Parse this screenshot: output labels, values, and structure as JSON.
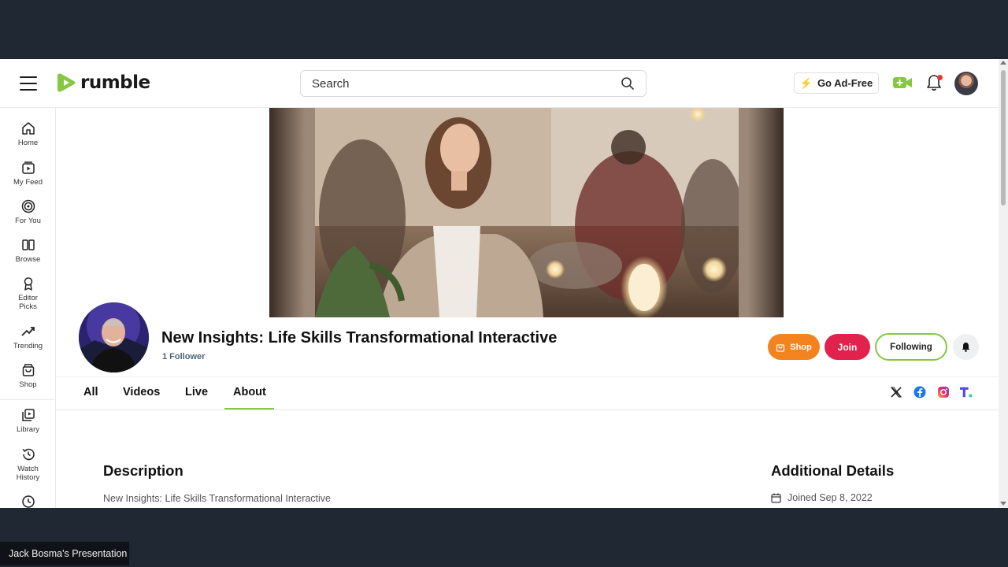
{
  "browser": {
    "logo_text": "rumble",
    "search": {
      "placeholder": "Search"
    },
    "go_adfree_label": "Go Ad-Free",
    "accent_color": "#85c742"
  },
  "sidebar": {
    "items": [
      {
        "label": "Home",
        "icon": "home-icon"
      },
      {
        "label": "My Feed",
        "icon": "feed-icon"
      },
      {
        "label": "For You",
        "icon": "target-icon"
      },
      {
        "label": "Browse",
        "icon": "browse-icon"
      },
      {
        "label": "Editor Picks",
        "icon": "ribbon-icon"
      },
      {
        "label": "Trending",
        "icon": "trending-icon"
      },
      {
        "label": "Shop",
        "icon": "shop-icon"
      },
      {
        "label": "Library",
        "icon": "library-icon"
      },
      {
        "label": "Watch History",
        "icon": "history-icon"
      }
    ]
  },
  "channel": {
    "title": "New Insights: Life Skills Transformational Interactive",
    "followers": "1 Follower",
    "shop_label": "Shop",
    "join_label": "Join",
    "following_label": "Following",
    "shop_color": "#f3831f",
    "join_color": "#e0224c"
  },
  "tabs": [
    {
      "label": "All",
      "active": false
    },
    {
      "label": "Videos",
      "active": false
    },
    {
      "label": "Live",
      "active": false
    },
    {
      "label": "About",
      "active": true
    }
  ],
  "social_links": [
    "x-icon",
    "facebook-icon",
    "instagram-icon",
    "truth-social-icon"
  ],
  "about": {
    "description_title": "Description",
    "description_text": "New Insights: Life Skills Transformational Interactive",
    "details_title": "Additional Details",
    "joined_text": "Joined Sep 8, 2022"
  },
  "presenter_tag": "Jack Bosma's Presentation"
}
